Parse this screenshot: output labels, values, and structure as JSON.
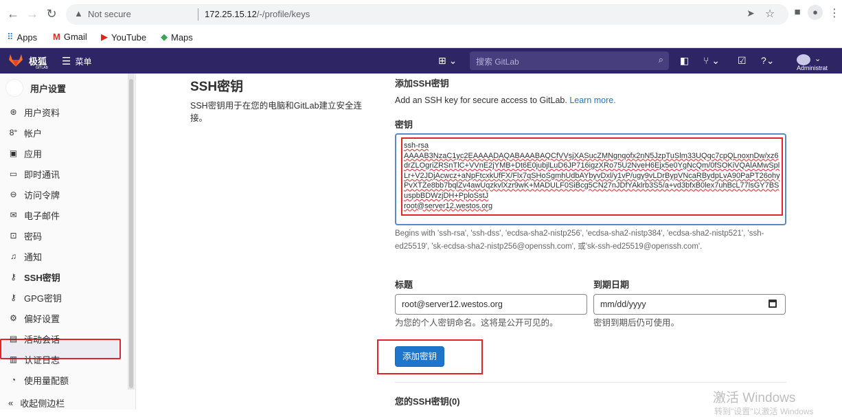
{
  "browser": {
    "security_label": "Not secure",
    "url_host": "172.25.15.12",
    "url_path": "/-/profile/keys",
    "bookmarks": [
      "Apps",
      "Gmail",
      "YouTube",
      "Maps"
    ]
  },
  "gitlab_header": {
    "brand": "极狐",
    "brand_sub": "GITLAB",
    "menu_label": "菜单",
    "search_placeholder": "搜索 GitLab",
    "user_label": "Administrat"
  },
  "sidebar": {
    "title": "用户设置",
    "items": [
      {
        "label": "用户资料",
        "icon": "user-icon"
      },
      {
        "label": "帐户",
        "icon": "account-icon"
      },
      {
        "label": "应用",
        "icon": "apps-icon"
      },
      {
        "label": "即时通讯",
        "icon": "chat-icon"
      },
      {
        "label": "访问令牌",
        "icon": "token-icon"
      },
      {
        "label": "电子邮件",
        "icon": "mail-icon"
      },
      {
        "label": "密码",
        "icon": "lock-icon"
      },
      {
        "label": "通知",
        "icon": "bell-icon"
      },
      {
        "label": "SSH密钥",
        "icon": "key-icon"
      },
      {
        "label": "GPG密钥",
        "icon": "key-icon"
      },
      {
        "label": "偏好设置",
        "icon": "preferences-icon"
      },
      {
        "label": "活动会话",
        "icon": "monitor-icon"
      },
      {
        "label": "认证日志",
        "icon": "log-icon"
      },
      {
        "label": "使用量配额",
        "icon": "quota-icon"
      }
    ],
    "active_item": "SSH密钥",
    "collapse_label": "收起侧边栏"
  },
  "page": {
    "title": "SSH密钥",
    "description": "SSH密钥用于在您的电脑和GitLab建立安全连接。"
  },
  "form": {
    "title": "添加SSH密钥",
    "subtitle": "Add an SSH key for secure access to GitLab.",
    "learn_more": "Learn more.",
    "key_label": "密钥",
    "key_value_lines": [
      "ssh-rsa",
      "AAAAB3NzaC1yc2EAAAADAQABAAABAQCfVVsjXASucZMNgnqofx2nN5JzpTuSlm33UQqc7cpQLnoxnDw/xz6drZLOgriZRSnTlC+VVnE2jYMB+Dt6E0jubjlLuD6JP716igzXRo75U2NveH6Ejx5e0YgNcQm/0fSOKiVQAlAMwSplLr+V2JDjAcwcz+aNpFtcxkUfFX/Flx7qSHoSgmhUdbAYbyvDxl/y1vP/ugy9vLDrBypVNcaRBydpLvA90PaPT26ohyPvXTZe8bb7bqlZv4awUqzkvlXzr9wK+MADULF0SiBcg5CN27nJDfYAklrb3S5/a+vd3bfxB0lex7uhBcL77lsGY7BSuspbBDWzjDH+PploSstJ",
      "root@server12.westos.org"
    ],
    "key_hint": "Begins with 'ssh-rsa', 'ssh-dss', 'ecdsa-sha2-nistp256', 'ecdsa-sha2-nistp384', 'ecdsa-sha2-nistp521', 'ssh-ed25519', 'sk-ecdsa-sha2-nistp256@openssh.com', 或'sk-ssh-ed25519@openssh.com'.",
    "title_label": "标题",
    "title_value": "root@server12.westos.org",
    "title_hint": "为您的个人密钥命名。这将是公开可见的。",
    "expiry_label": "到期日期",
    "expiry_placeholder": "mm/dd/yyyy",
    "expiry_hint": "密钥到期后仍可使用。",
    "submit_label": "添加密钥"
  },
  "your_keys_label": "您的SSH密钥(0)",
  "watermark": {
    "line1": "激活 Windows",
    "line2": "转到\"设置\"以激活 Windows"
  }
}
